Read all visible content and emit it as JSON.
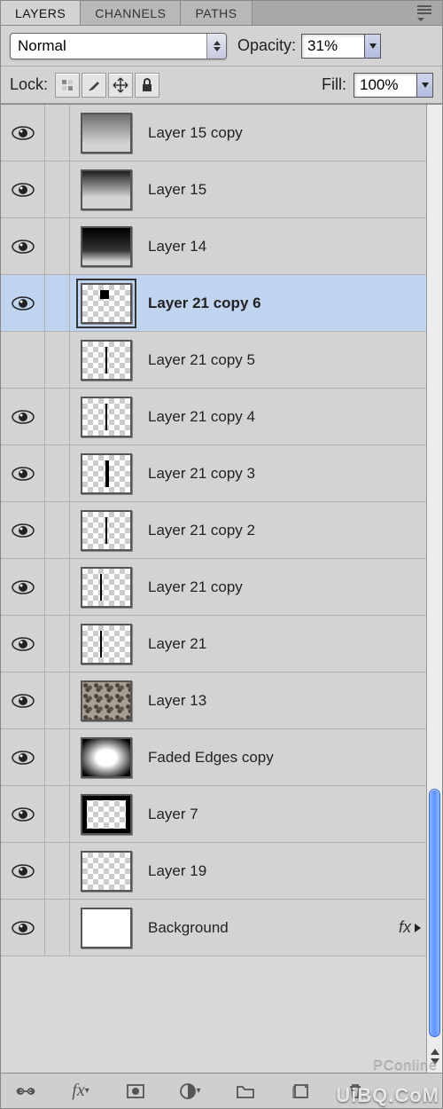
{
  "tabs": {
    "layers": "LAYERS",
    "channels": "CHANNELS",
    "paths": "PATHS"
  },
  "options": {
    "blend_mode": "Normal",
    "opacity_label": "Opacity:",
    "opacity_value": "31%",
    "lock_label": "Lock:",
    "fill_label": "Fill:",
    "fill_value": "100%"
  },
  "layers": [
    {
      "name": "Layer 15 copy",
      "visible": true,
      "selected": false,
      "thumb": "checker grad-gray",
      "fx": false
    },
    {
      "name": "Layer 15",
      "visible": true,
      "selected": false,
      "thumb": "checker grad-top",
      "fx": false
    },
    {
      "name": "Layer 14",
      "visible": true,
      "selected": false,
      "thumb": "checker grad-dark",
      "fx": false
    },
    {
      "name": "Layer 21 copy 6",
      "visible": true,
      "selected": true,
      "thumb": "checker line-center line-l corners",
      "fx": false
    },
    {
      "name": "Layer 21 copy 5",
      "visible": false,
      "selected": false,
      "thumb": "checker line-center line-c",
      "fx": false
    },
    {
      "name": "Layer 21 copy 4",
      "visible": true,
      "selected": false,
      "thumb": "checker line-center line-c",
      "fx": false
    },
    {
      "name": "Layer 21 copy 3",
      "visible": true,
      "selected": false,
      "thumb": "checker line-center line-c line-thick",
      "fx": false
    },
    {
      "name": "Layer 21 copy 2",
      "visible": true,
      "selected": false,
      "thumb": "checker line-center line-c",
      "fx": false
    },
    {
      "name": "Layer 21 copy",
      "visible": true,
      "selected": false,
      "thumb": "checker line-center line-l",
      "fx": false
    },
    {
      "name": "Layer 21",
      "visible": true,
      "selected": false,
      "thumb": "checker line-center line-l",
      "fx": false
    },
    {
      "name": "Layer 13",
      "visible": true,
      "selected": false,
      "thumb": "grunge",
      "fx": false
    },
    {
      "name": "Faded Edges copy",
      "visible": true,
      "selected": false,
      "thumb": "vignette",
      "fx": false
    },
    {
      "name": "Layer 7",
      "visible": true,
      "selected": false,
      "thumb": "checker black-border",
      "fx": false
    },
    {
      "name": "Layer 19",
      "visible": true,
      "selected": false,
      "thumb": "checker",
      "fx": false
    },
    {
      "name": "Background",
      "visible": true,
      "selected": false,
      "thumb": "white-fill",
      "fx": true
    }
  ],
  "fx_label": "fx",
  "watermark": "UiBQ.CoM",
  "watermark2": "PConline"
}
